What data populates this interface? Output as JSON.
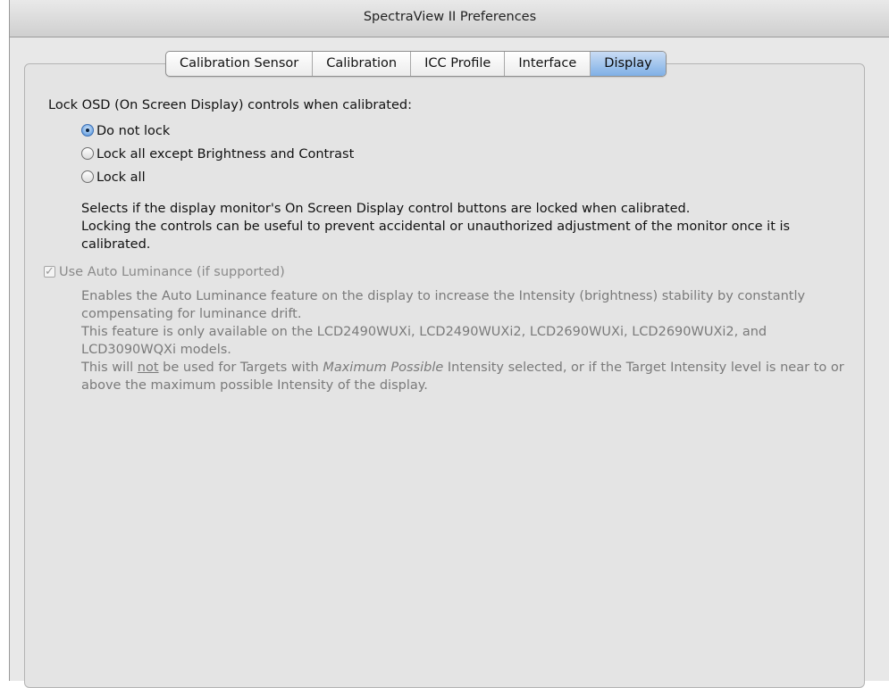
{
  "window": {
    "title": "SpectraView II Preferences"
  },
  "tabs": [
    {
      "label": "Calibration Sensor",
      "active": false
    },
    {
      "label": "Calibration",
      "active": false
    },
    {
      "label": "ICC Profile",
      "active": false
    },
    {
      "label": "Interface",
      "active": false
    },
    {
      "label": "Display",
      "active": true
    }
  ],
  "osd": {
    "heading": "Lock OSD (On Screen Display) controls when calibrated:",
    "options": [
      {
        "label": "Do not lock",
        "selected": true
      },
      {
        "label": "Lock all except Brightness and Contrast",
        "selected": false
      },
      {
        "label": "Lock all",
        "selected": false
      }
    ],
    "description_line1": "Selects if the display monitor's On Screen Display control buttons are locked when calibrated.",
    "description_line2": "Locking the controls can be useful to prevent accidental or unauthorized adjustment of the monitor once it is calibrated."
  },
  "auto_luminance": {
    "label": "Use Auto Luminance (if supported)",
    "checked": true,
    "enabled": false,
    "desc_line1": "Enables the Auto Luminance feature on the display to increase the Intensity (brightness) stability by constantly compensating for luminance drift.",
    "desc_line2": "This feature is only available on the LCD2490WUXi, LCD2490WUXi2, LCD2690WUXi, LCD2690WUXi2, and LCD3090WQXi models.",
    "desc_line3_part1": "This will ",
    "desc_line3_not": "not",
    "desc_line3_part2": " be used for Targets with ",
    "desc_line3_italic": "Maximum Possible",
    "desc_line3_part3": " Intensity selected, or if the Target Intensity level is near to or above the maximum possible Intensity of the display."
  },
  "colors": {
    "active_tab": "#7fb0e6",
    "window_bg": "#e8e8e8",
    "disabled_text": "#7a7a7a"
  }
}
